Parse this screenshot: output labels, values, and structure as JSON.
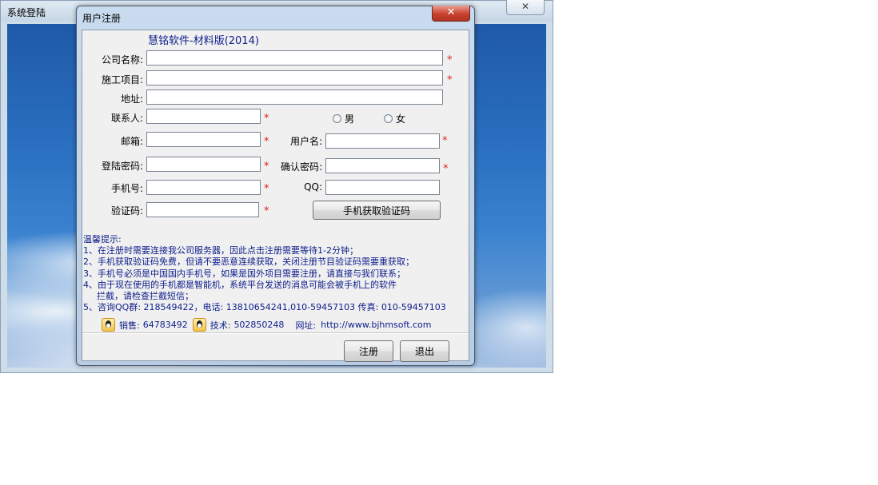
{
  "background_window": {
    "title": "系统登陆",
    "close_glyph": "✕"
  },
  "dialog": {
    "title": "用户注册",
    "close_glyph": "✕",
    "app_title": "慧铭软件-材料版(2014)"
  },
  "form": {
    "company": {
      "label": "公司名称:",
      "value": "",
      "required": "*"
    },
    "project": {
      "label": "施工项目:",
      "value": "",
      "required": "*"
    },
    "address": {
      "label": "地址:",
      "value": ""
    },
    "contact": {
      "label": "联系人:",
      "value": "",
      "required": "*"
    },
    "gender": {
      "male": "男",
      "female": "女"
    },
    "email": {
      "label": "邮箱:",
      "value": "",
      "required": "*"
    },
    "username": {
      "label": "用户名:",
      "value": "",
      "required": "*"
    },
    "password": {
      "label": "登陆密码:",
      "value": "",
      "required": "*"
    },
    "confirm_password": {
      "label": "确认密码:",
      "value": "",
      "required": "*"
    },
    "phone": {
      "label": "手机号:",
      "value": "",
      "required": "*"
    },
    "qq": {
      "label": "QQ:",
      "value": ""
    },
    "verify_code": {
      "label": "验证码:",
      "value": "",
      "required": "*"
    },
    "get_code_button": "手机获取验证码"
  },
  "tips": {
    "heading": "温馨提示:",
    "lines": [
      "1、在注册时需要连接我公司服务器，因此点击注册需要等待1-2分钟；",
      "2、手机获取验证码免费，但请不要恶意连续获取，关闭注册节目验证码需要重获取；",
      "3、手机号必须是中国国内手机号，如果是国外项目需要注册，请直接与我们联系；",
      "4、由于现在使用的手机都是智能机，系统平台发送的消息可能会被手机上的软件",
      "拦截，请检查拦截短信；",
      "5、咨询QQ群: 218549422，电话: 13810654241,010-59457103 传真: 010-59457103"
    ]
  },
  "contact_info": {
    "sales_label": "销售:",
    "sales_qq": "64783492",
    "tech_label": "技术:",
    "tech_qq": "502850248",
    "website_label": "网址:",
    "website": "http://www.bjhmsoft.com"
  },
  "buttons": {
    "register": "注册",
    "exit": "退出"
  }
}
